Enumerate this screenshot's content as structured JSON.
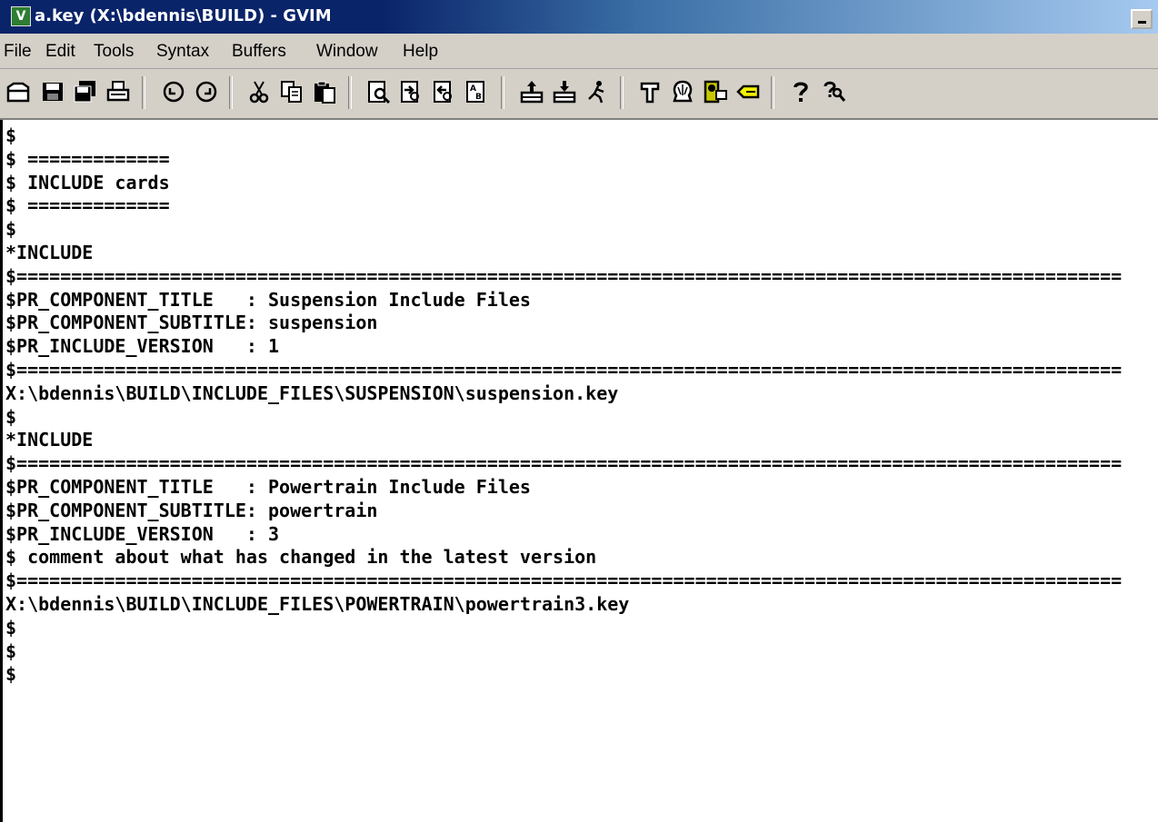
{
  "window": {
    "title": "a.key (X:\\bdennis\\BUILD) - GVIM",
    "app_icon_glyph": "V"
  },
  "menu": {
    "items": [
      "File",
      "Edit",
      "Tools",
      "Syntax",
      "Buffers",
      "Window",
      "Help"
    ]
  },
  "toolbar": {
    "icons": [
      "open-icon",
      "save-icon",
      "save-all-icon",
      "print-icon",
      "undo-icon",
      "redo-icon",
      "cut-icon",
      "copy-icon",
      "paste-icon",
      "find-icon",
      "find-next-icon",
      "find-previous-icon",
      "replace-icon",
      "load-session-icon",
      "save-session-icon",
      "run-script-icon",
      "make-icon",
      "shell-icon",
      "ctags-icon",
      "tag-jump-icon",
      "help-icon",
      "help-find-icon"
    ]
  },
  "editor": {
    "lines": [
      "$",
      "$ =============",
      "$ INCLUDE cards",
      "$ =============",
      "$",
      "*INCLUDE",
      "$=====================================================================================================",
      "$PR_COMPONENT_TITLE   : Suspension Include Files",
      "$PR_COMPONENT_SUBTITLE: suspension",
      "$PR_INCLUDE_VERSION   : 1",
      "$=====================================================================================================",
      "X:\\bdennis\\BUILD\\INCLUDE_FILES\\SUSPENSION\\suspension.key",
      "$",
      "*INCLUDE",
      "$=====================================================================================================",
      "$PR_COMPONENT_TITLE   : Powertrain Include Files",
      "$PR_COMPONENT_SUBTITLE: powertrain",
      "$PR_INCLUDE_VERSION   : 3",
      "$ comment about what has changed in the latest version",
      "$=====================================================================================================",
      "X:\\bdennis\\BUILD\\INCLUDE_FILES\\POWERTRAIN\\powertrain3.key",
      "$",
      "$",
      "$"
    ]
  }
}
